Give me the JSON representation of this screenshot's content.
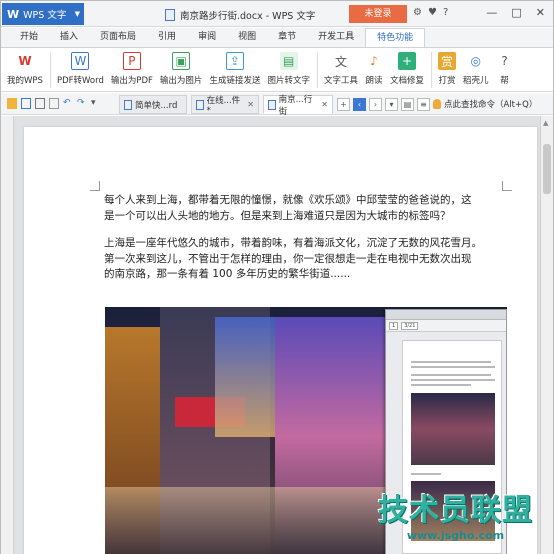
{
  "app": {
    "logo": "W",
    "name": "WPS 文字",
    "title": "南京路步行街.docx - WPS 文字",
    "login_label": "未登录",
    "window_controls": [
      "—",
      "□",
      "✕"
    ]
  },
  "menu_tabs": [
    "开始",
    "插入",
    "页面布局",
    "引用",
    "审阅",
    "视图",
    "章节",
    "开发工具",
    "特色功能"
  ],
  "active_menu_tab": "特色功能",
  "ribbon": {
    "buttons": [
      {
        "label": "我的WPS",
        "icon": "wps-logo-icon",
        "color": "#d63b32"
      },
      {
        "label": "PDF转Word",
        "icon": "pdf-to-word-icon",
        "color": "#3a78d3"
      },
      {
        "label": "输出为PDF",
        "icon": "export-pdf-icon",
        "color": "#d33b32"
      },
      {
        "label": "输出为图片",
        "icon": "export-image-icon",
        "color": "#3aa05a"
      },
      {
        "label": "生成链接发送",
        "icon": "share-link-icon",
        "color": "#3a9ad3"
      },
      {
        "label": "图片转文字",
        "icon": "ocr-icon",
        "color": "#3aa05a"
      },
      {
        "label": "文字工具",
        "icon": "text-tools-icon",
        "color": "#555555"
      },
      {
        "label": "朗读",
        "icon": "read-aloud-icon",
        "color": "#e07a3a"
      },
      {
        "label": "文档修复",
        "icon": "doc-repair-icon",
        "color": "#2fb07a"
      },
      {
        "label": "打赏",
        "icon": "reward-icon",
        "color": "#e8a72f"
      },
      {
        "label": "稻壳儿",
        "icon": "docer-icon",
        "color": "#3a78d3"
      },
      {
        "label": "帮",
        "icon": "help-icon",
        "color": "#555555"
      }
    ]
  },
  "doc_tabs": [
    {
      "label": "简单快...rd",
      "active": false
    },
    {
      "label": "在线...件 *",
      "active": false
    },
    {
      "label": "南京...行街",
      "active": true
    }
  ],
  "search_command": "点此查找命令（Alt+Q）",
  "document": {
    "paragraphs": [
      [
        "每个人来到上海，都带着无限的憧憬，就像《欢乐颂》中邱莹莹的爸爸说的，这",
        "是一个可以出人头地的地方。但是来到上海难道只是因为大城市的标签吗？"
      ],
      [
        "上海是一座年代悠久的城市，带着韵味，有着海派文化，沉淀了无数的风花雪月。",
        "第一次来到这儿，不管出于怎样的理由，你一定很想走一走在电视中无数次出现",
        "的南京路，那一条有着 100 多年历史的繁华街道......"
      ]
    ],
    "inset_page_field": "1",
    "inset_zoom_field": "3/21"
  },
  "watermark": {
    "big": "技术员联盟",
    "url": "www.jsgho.com"
  }
}
